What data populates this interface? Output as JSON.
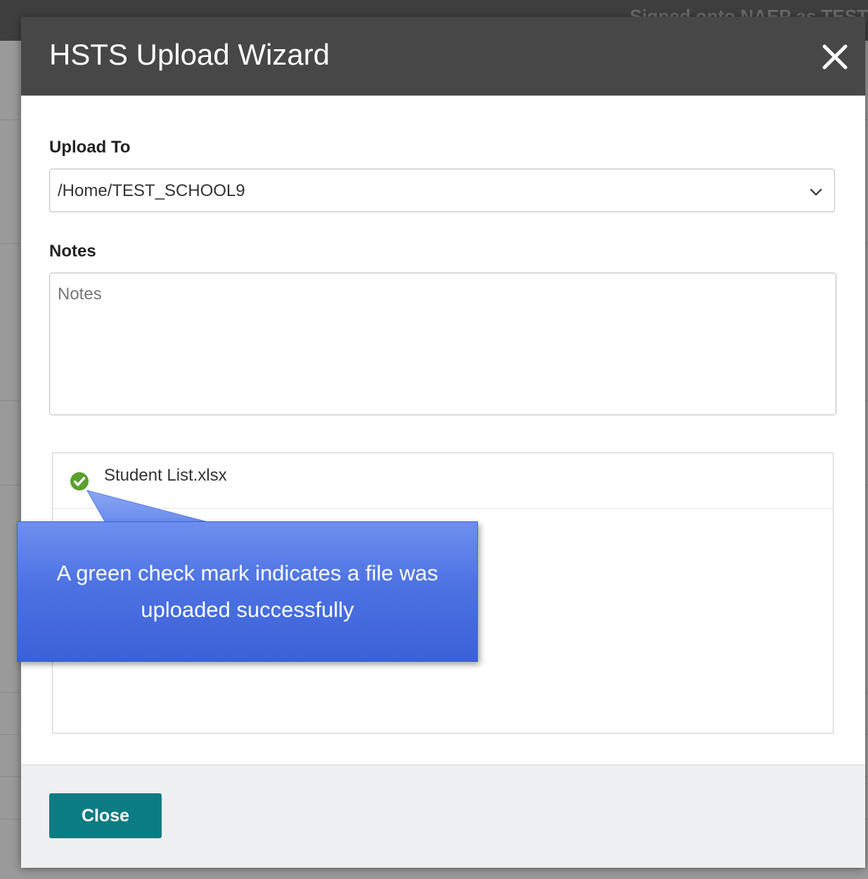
{
  "background": {
    "header_fragment": "Signed onto NAEP as TEST"
  },
  "modal": {
    "title": "HSTS Upload Wizard",
    "upload_to": {
      "label": "Upload To",
      "selected_value": "/Home/TEST_SCHOOL9"
    },
    "notes": {
      "label": "Notes",
      "placeholder": "Notes",
      "value": ""
    },
    "files": [
      {
        "name": "Student List.xlsx",
        "status": "success",
        "status_icon": "check-circle-icon"
      }
    ],
    "footer": {
      "close_label": "Close"
    }
  },
  "callout": {
    "text": "A green check mark indicates a file was uploaded successfully"
  },
  "colors": {
    "header_bg": "#474747",
    "primary_button": "#0c7c84",
    "success_green": "#5aa02c",
    "callout_blue": "#4d72e2"
  }
}
